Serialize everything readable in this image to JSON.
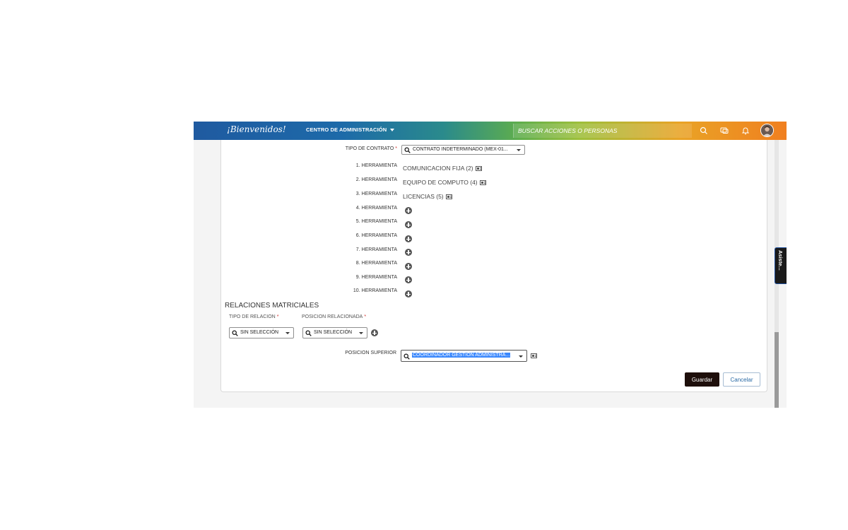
{
  "topbar": {
    "logo": "¡Bienvenidos!",
    "admin_menu": "CENTRO DE ADMINISTRACIÓN",
    "search_placeholder": "BUSCAR ACCIONES O PERSONAS",
    "icons": [
      "search-icon",
      "chat-icon",
      "bell-icon",
      "avatar"
    ]
  },
  "form": {
    "tipo_contrato_label": "TIPO DE CONTRATO",
    "tipo_contrato_value": "CONTRATO INDETERMINADO (MEX-01...",
    "herramientas": [
      {
        "label": "1. HERRAMIENTA",
        "value": "COMUNICACION FIJA (2)"
      },
      {
        "label": "2. HERRAMIENTA",
        "value": "EQUIPO DE COMPUTO (4)"
      },
      {
        "label": "3. HERRAMIENTA",
        "value": "LICENCIAS (5)"
      },
      {
        "label": "4. HERRAMIENTA",
        "value": ""
      },
      {
        "label": "5. HERRAMIENTA",
        "value": ""
      },
      {
        "label": "6. HERRAMIENTA",
        "value": ""
      },
      {
        "label": "7. HERRAMIENTA",
        "value": ""
      },
      {
        "label": "8. HERRAMIENTA",
        "value": ""
      },
      {
        "label": "9. HERRAMIENTA",
        "value": ""
      },
      {
        "label": "10. HERRAMIENTA",
        "value": ""
      }
    ],
    "relaciones_title": "RELACIONES MATRICIALES",
    "tipo_relacion_label": "TIPO DE RELACION",
    "tipo_relacion_value": "SIN SELECCIÓN",
    "posicion_relacionada_label": "POSICION RELACIONADA",
    "posicion_relacionada_value": "SIN SELECCIÓN",
    "posicion_superior_label": "POSICION SUPERIOR",
    "posicion_superior_value": "COORDINADOR GESTION ADMINISTRA..."
  },
  "buttons": {
    "guardar": "Guardar",
    "cancelar": "Cancelar"
  },
  "side_tab": "Asiste...",
  "colors": {
    "primary_button": "#1e0f0b",
    "selection_highlight": "#3b88fd",
    "required_marker": "#d0312d"
  }
}
